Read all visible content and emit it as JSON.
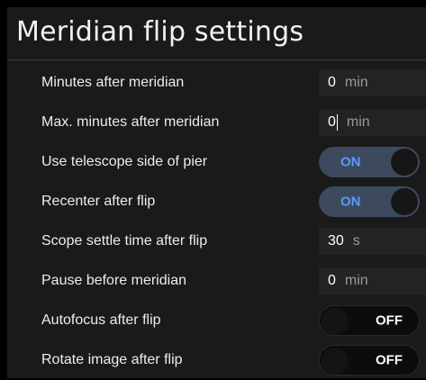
{
  "title": "Meridian flip settings",
  "settings": [
    {
      "label": "Minutes after meridian",
      "value": "0",
      "unit": "min"
    },
    {
      "label": "Max. minutes after meridian",
      "value": "0",
      "unit": "min"
    },
    {
      "label": "Use telescope side of pier",
      "state": "ON"
    },
    {
      "label": "Recenter after flip",
      "state": "ON"
    },
    {
      "label": "Scope settle time after flip",
      "value": "30",
      "unit": "s"
    },
    {
      "label": "Pause before meridian",
      "value": "0",
      "unit": "min"
    },
    {
      "label": "Autofocus after flip",
      "state": "OFF"
    },
    {
      "label": "Rotate image after flip",
      "state": "OFF"
    }
  ],
  "colors": {
    "toggle_on_text": "#5b9bff",
    "toggle_on_bg": "#3d4a5e",
    "panel": "#1a1a1a"
  }
}
